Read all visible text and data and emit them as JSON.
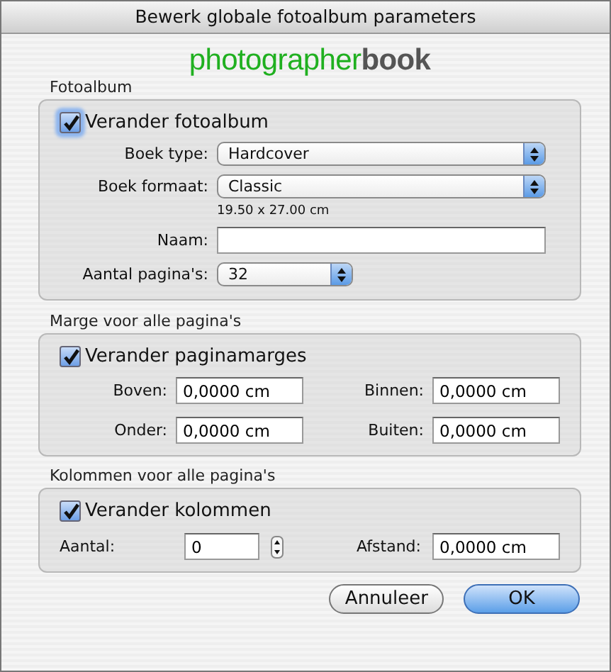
{
  "window": {
    "title": "Bewerk globale fotoalbum parameters"
  },
  "logo": {
    "part_1": "photographer",
    "part_2": "book"
  },
  "fotoalbum": {
    "heading": "Fotoalbum",
    "checkbox": {
      "label": "Verander fotoalbum",
      "checked": true,
      "focused": true
    },
    "boek_type": {
      "label": "Boek type:",
      "value": "Hardcover"
    },
    "boek_formaat": {
      "label": "Boek formaat:",
      "value": "Classic"
    },
    "size_note": "19.50 x 27.00 cm",
    "naam": {
      "label": "Naam:"
    },
    "aantal_paginas": {
      "label": "Aantal pagina's:",
      "value": "32"
    }
  },
  "marges": {
    "heading": "Marge voor alle pagina's",
    "checkbox": {
      "label": "Verander paginamarges",
      "checked": true,
      "focused": false
    },
    "fields": [
      {
        "label": "Boven:",
        "value": "0,0000 cm"
      },
      {
        "label": "Binnen:",
        "value": "0,0000 cm"
      },
      {
        "label": "Onder:",
        "value": "0,0000 cm"
      },
      {
        "label": "Buiten:",
        "value": "0,0000 cm"
      }
    ]
  },
  "kolommen": {
    "heading": "Kolommen voor alle pagina's",
    "checkbox": {
      "label": "Verander kolommen",
      "checked": true,
      "focused": false
    },
    "aantal": {
      "label": "Aantal:",
      "value": "0"
    },
    "afstand": {
      "label": "Afstand:",
      "value": "0,0000 cm"
    }
  },
  "buttons": [
    {
      "label": "Annuleer",
      "default": false
    },
    {
      "label": "OK",
      "default": true
    }
  ]
}
